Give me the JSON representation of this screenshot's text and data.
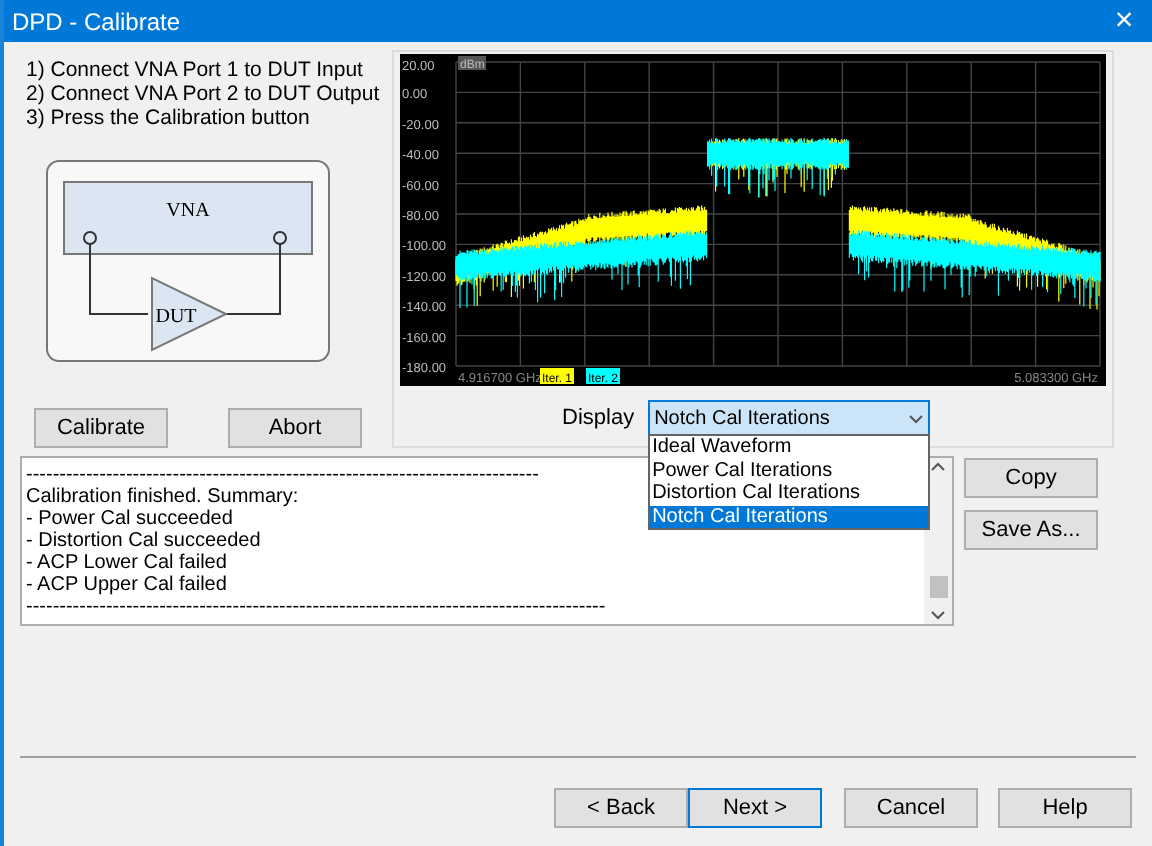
{
  "window": {
    "title": "DPD - Calibrate",
    "close": "×"
  },
  "instructions": [
    "1) Connect VNA Port 1 to DUT Input",
    "2) Connect VNA Port 2 to DUT Output",
    "3) Press the Calibration button"
  ],
  "diagram": {
    "instrument": "VNA",
    "device": "DUT"
  },
  "actions": [
    "Calibrate",
    "Abort"
  ],
  "plot": {
    "unit": "dBm",
    "y_labels": [
      "20.00",
      "0.00",
      "-20.00",
      "-40.00",
      "-60.00",
      "-80.00",
      "-100.00",
      "-120.00",
      "-140.00",
      "-160.00",
      "-180.00"
    ],
    "x_start": "4.916700 GHz",
    "x_end": "5.083300 GHz",
    "legend": [
      {
        "label": "Iter. 1",
        "color": "#ffff00"
      },
      {
        "label": "Iter. 2",
        "color": "#00ffff"
      }
    ]
  },
  "display": {
    "label": "Display",
    "value": "Notch Cal Iterations",
    "expanded": true,
    "options": [
      {
        "label": "Ideal Waveform",
        "selected": false
      },
      {
        "label": "Power Cal Iterations",
        "selected": false
      },
      {
        "label": "Distortion Cal Iterations",
        "selected": false
      },
      {
        "label": "Notch Cal Iterations",
        "selected": true
      }
    ]
  },
  "log": {
    "lines": [
      "-----------------------------------------------------------------------------",
      "Calibration finished. Summary:",
      "- Power Cal succeeded",
      "- Distortion Cal succeeded",
      "- ACP Lower Cal failed",
      "- ACP Upper Cal failed",
      "---------------------------------------------------------------------------------------"
    ]
  },
  "log_buttons": [
    "Copy",
    "Save As..."
  ],
  "footer": [
    {
      "label": "< Back",
      "default": false
    },
    {
      "label": "Next >",
      "default": true
    },
    {
      "label": "Cancel",
      "default": false
    },
    {
      "label": "Help",
      "default": false
    }
  ]
}
